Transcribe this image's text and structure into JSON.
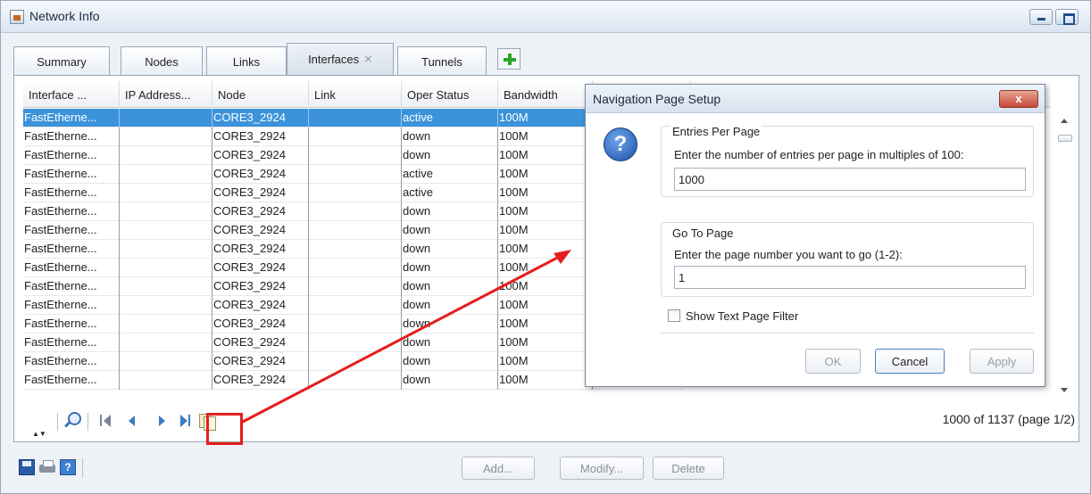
{
  "window": {
    "title": "Network Info"
  },
  "tabs": [
    {
      "label": "Summary"
    },
    {
      "label": "Nodes"
    },
    {
      "label": "Links"
    },
    {
      "label": "Interfaces",
      "close": "×"
    },
    {
      "label": "Tunnels"
    }
  ],
  "table": {
    "columns": [
      "Interface ...",
      "IP Address...",
      "Node",
      "Link",
      "Oper Status",
      "Bandwidth"
    ],
    "rows": [
      [
        "FastEtherne...",
        "",
        "CORE3_2924",
        "",
        "active",
        "100M"
      ],
      [
        "FastEtherne...",
        "",
        "CORE3_2924",
        "",
        "down",
        "100M"
      ],
      [
        "FastEtherne...",
        "",
        "CORE3_2924",
        "",
        "down",
        "100M"
      ],
      [
        "FastEtherne...",
        "",
        "CORE3_2924",
        "",
        "active",
        "100M"
      ],
      [
        "FastEtherne...",
        "",
        "CORE3_2924",
        "",
        "active",
        "100M"
      ],
      [
        "FastEtherne...",
        "",
        "CORE3_2924",
        "",
        "down",
        "100M"
      ],
      [
        "FastEtherne...",
        "",
        "CORE3_2924",
        "",
        "down",
        "100M"
      ],
      [
        "FastEtherne...",
        "",
        "CORE3_2924",
        "",
        "down",
        "100M"
      ],
      [
        "FastEtherne...",
        "",
        "CORE3_2924",
        "",
        "down",
        "100M"
      ],
      [
        "FastEtherne...",
        "",
        "CORE3_2924",
        "",
        "down",
        "100M"
      ],
      [
        "FastEtherne...",
        "",
        "CORE3_2924",
        "",
        "down",
        "100M"
      ],
      [
        "FastEtherne...",
        "",
        "CORE3_2924",
        "",
        "down",
        "100M"
      ],
      [
        "FastEtherne...",
        "",
        "CORE3_2924",
        "",
        "down",
        "100M"
      ],
      [
        "FastEtherne...",
        "",
        "CORE3_2924",
        "",
        "down",
        "100M"
      ],
      [
        "FastEtherne...",
        "",
        "CORE3_2924",
        "",
        "down",
        "100M"
      ]
    ],
    "selected_row": 0
  },
  "pager": {
    "status": "1000 of 1137 (page 1/2)",
    "resize_glyph": "▲▼"
  },
  "actions": {
    "add": "Add...",
    "modify": "Modify...",
    "delete": "Delete",
    "help_glyph": "?"
  },
  "dialog": {
    "title": "Navigation Page Setup",
    "close_glyph": "x",
    "question_glyph": "?",
    "entries_group": {
      "title": "Entries Per Page",
      "label": "Enter the number of entries per page in multiples of 100:",
      "value": "1000"
    },
    "goto_group": {
      "title": "Go To Page",
      "label": "Enter the page number you want to go (1-2):",
      "value": "1"
    },
    "filter_label": "Show Text Page Filter",
    "filter_checked": false,
    "buttons": {
      "ok": "OK",
      "cancel": "Cancel",
      "apply": "Apply"
    }
  },
  "colors": {
    "selection": "#3c93dc",
    "annotation": "#e51d1d"
  }
}
